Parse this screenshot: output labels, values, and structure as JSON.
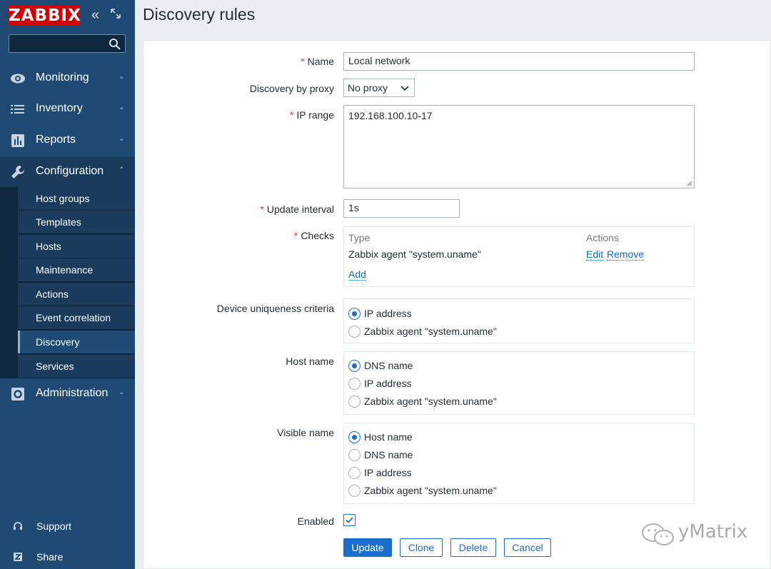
{
  "sidebar": {
    "logo": "ZABBIX",
    "search_placeholder": "",
    "menu": [
      {
        "label": "Monitoring",
        "icon": "eye-icon"
      },
      {
        "label": "Inventory",
        "icon": "list-icon"
      },
      {
        "label": "Reports",
        "icon": "bar-chart-icon"
      },
      {
        "label": "Configuration",
        "icon": "wrench-icon"
      },
      {
        "label": "Administration",
        "icon": "cog-icon"
      }
    ],
    "submenu": [
      "Host groups",
      "Templates",
      "Hosts",
      "Maintenance",
      "Actions",
      "Event correlation",
      "Discovery",
      "Services"
    ],
    "selected_submenu": "Discovery",
    "bottom": [
      {
        "label": "Support",
        "icon": "headset-icon"
      },
      {
        "label": "Share",
        "icon": "share-icon"
      }
    ]
  },
  "page": {
    "title": "Discovery rules"
  },
  "form": {
    "name_label": "Name",
    "name_value": "Local network",
    "proxy_label": "Discovery by proxy",
    "proxy_value": "No proxy",
    "ip_range_label": "IP range",
    "ip_range_value": "192.168.100.10-17",
    "update_interval_label": "Update interval",
    "update_interval_value": "1s",
    "checks_label": "Checks",
    "checks": {
      "col_type": "Type",
      "col_actions": "Actions",
      "rows": [
        {
          "type": "Zabbix agent \"system.uname\"",
          "edit": "Edit",
          "remove": "Remove"
        }
      ],
      "add": "Add"
    },
    "uniqueness_label": "Device uniqueness criteria",
    "uniqueness_options": [
      "IP address",
      "Zabbix agent \"system.uname\""
    ],
    "uniqueness_selected": "IP address",
    "hostname_label": "Host name",
    "hostname_options": [
      "DNS name",
      "IP address",
      "Zabbix agent \"system.uname\""
    ],
    "hostname_selected": "DNS name",
    "visiblename_label": "Visible name",
    "visiblename_options": [
      "Host name",
      "DNS name",
      "IP address",
      "Zabbix agent \"system.uname\""
    ],
    "visiblename_selected": "Host name",
    "enabled_label": "Enabled",
    "enabled": true
  },
  "buttons": {
    "update": "Update",
    "clone": "Clone",
    "delete": "Delete",
    "cancel": "Cancel"
  },
  "watermark": "yMatrix",
  "colors": {
    "sidebar": "#1f4a73",
    "accent": "#1a6ecd",
    "logo": "#d40000",
    "required": "#e33734"
  }
}
